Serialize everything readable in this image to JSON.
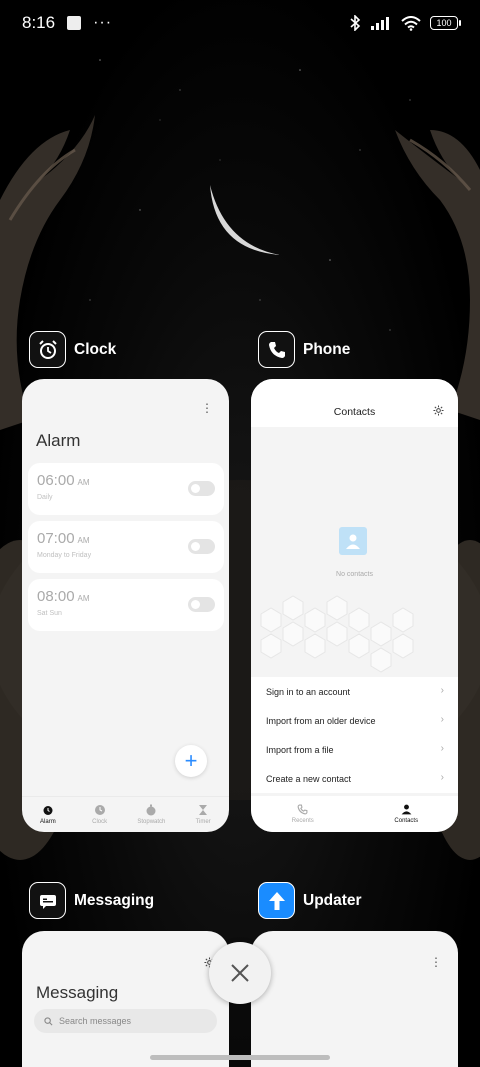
{
  "status_bar": {
    "time": "8:16",
    "dots": "···",
    "battery": "100"
  },
  "apps": {
    "clock": {
      "name": "Clock",
      "title": "Alarm",
      "alarms": [
        {
          "time": "06:00",
          "ampm": "AM",
          "label": "Daily",
          "enabled": false
        },
        {
          "time": "07:00",
          "ampm": "AM",
          "label": "Monday to Friday",
          "enabled": false
        },
        {
          "time": "08:00",
          "ampm": "AM",
          "label": "Sat Sun",
          "enabled": false
        }
      ],
      "fab": "+",
      "nav": [
        "Alarm",
        "Clock",
        "Stopwatch",
        "Timer"
      ]
    },
    "phone": {
      "name": "Phone",
      "title": "Contacts",
      "empty_text": "No contacts",
      "menu": [
        "Sign in to an account",
        "Import from an older device",
        "Import from a file",
        "Create a new contact"
      ],
      "chevron": "›",
      "nav": [
        "Recents",
        "Contacts"
      ]
    },
    "messaging": {
      "name": "Messaging",
      "title": "Messaging",
      "search_placeholder": "Search messages"
    },
    "updater": {
      "name": "Updater"
    }
  },
  "colors": {
    "accent_blue": "#2b8cff",
    "updater_icon": "#1a8cff",
    "card_bg": "#f4f4f4"
  }
}
